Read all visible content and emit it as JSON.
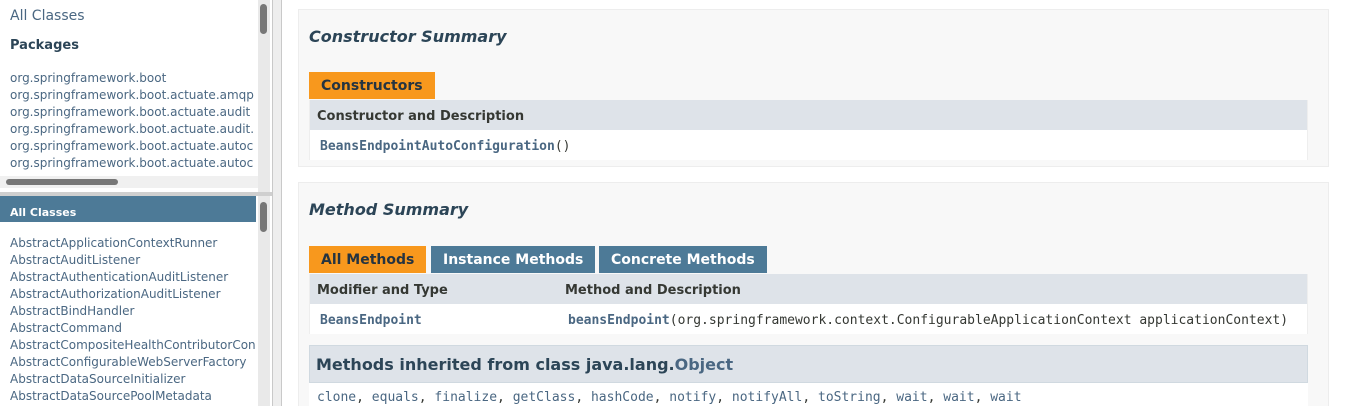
{
  "package_frame": {
    "all_classes_link": "All Classes",
    "packages_title": "Packages",
    "packages": [
      "org.springframework.boot",
      "org.springframework.boot.actuate.amqp",
      "org.springframework.boot.actuate.audit",
      "org.springframework.boot.actuate.audit.",
      "org.springframework.boot.actuate.autoc",
      "org.springframework.boot.actuate.autoc"
    ]
  },
  "class_frame": {
    "title": "All Classes",
    "classes": [
      "AbstractApplicationContextRunner",
      "AbstractAuditListener",
      "AbstractAuthenticationAuditListener",
      "AbstractAuthorizationAuditListener",
      "AbstractBindHandler",
      "AbstractCommand",
      "AbstractCompositeHealthContributorCon",
      "AbstractConfigurableWebServerFactory",
      "AbstractDataSourceInitializer",
      "AbstractDataSourcePoolMetadata"
    ]
  },
  "constructor_summary": {
    "heading": "Constructor Summary",
    "tab": "Constructors",
    "header": "Constructor and Description",
    "constructor_name": "BeansEndpointAutoConfiguration",
    "constructor_params": "()"
  },
  "method_summary": {
    "heading": "Method Summary",
    "tabs": [
      "All Methods",
      "Instance Methods",
      "Concrete Methods"
    ],
    "col_type": "Modifier and Type",
    "col_method": "Method and Description",
    "row": {
      "type": "BeansEndpoint",
      "method_name": "beansEndpoint",
      "method_params": "(org.springframework.context.ConfigurableApplicationContext applicationContext)"
    },
    "inherited_prefix": "Methods inherited from class java.lang.",
    "inherited_class": "Object",
    "inherited_methods": [
      "clone",
      "equals",
      "finalize",
      "getClass",
      "hashCode",
      "notify",
      "notifyAll",
      "toString",
      "wait",
      "wait",
      "wait"
    ]
  },
  "colors": {
    "active_tab": "#f8981d",
    "inactive_tab": "#4d7a97",
    "table_header": "#dee3e9",
    "link": "#4a6782"
  }
}
